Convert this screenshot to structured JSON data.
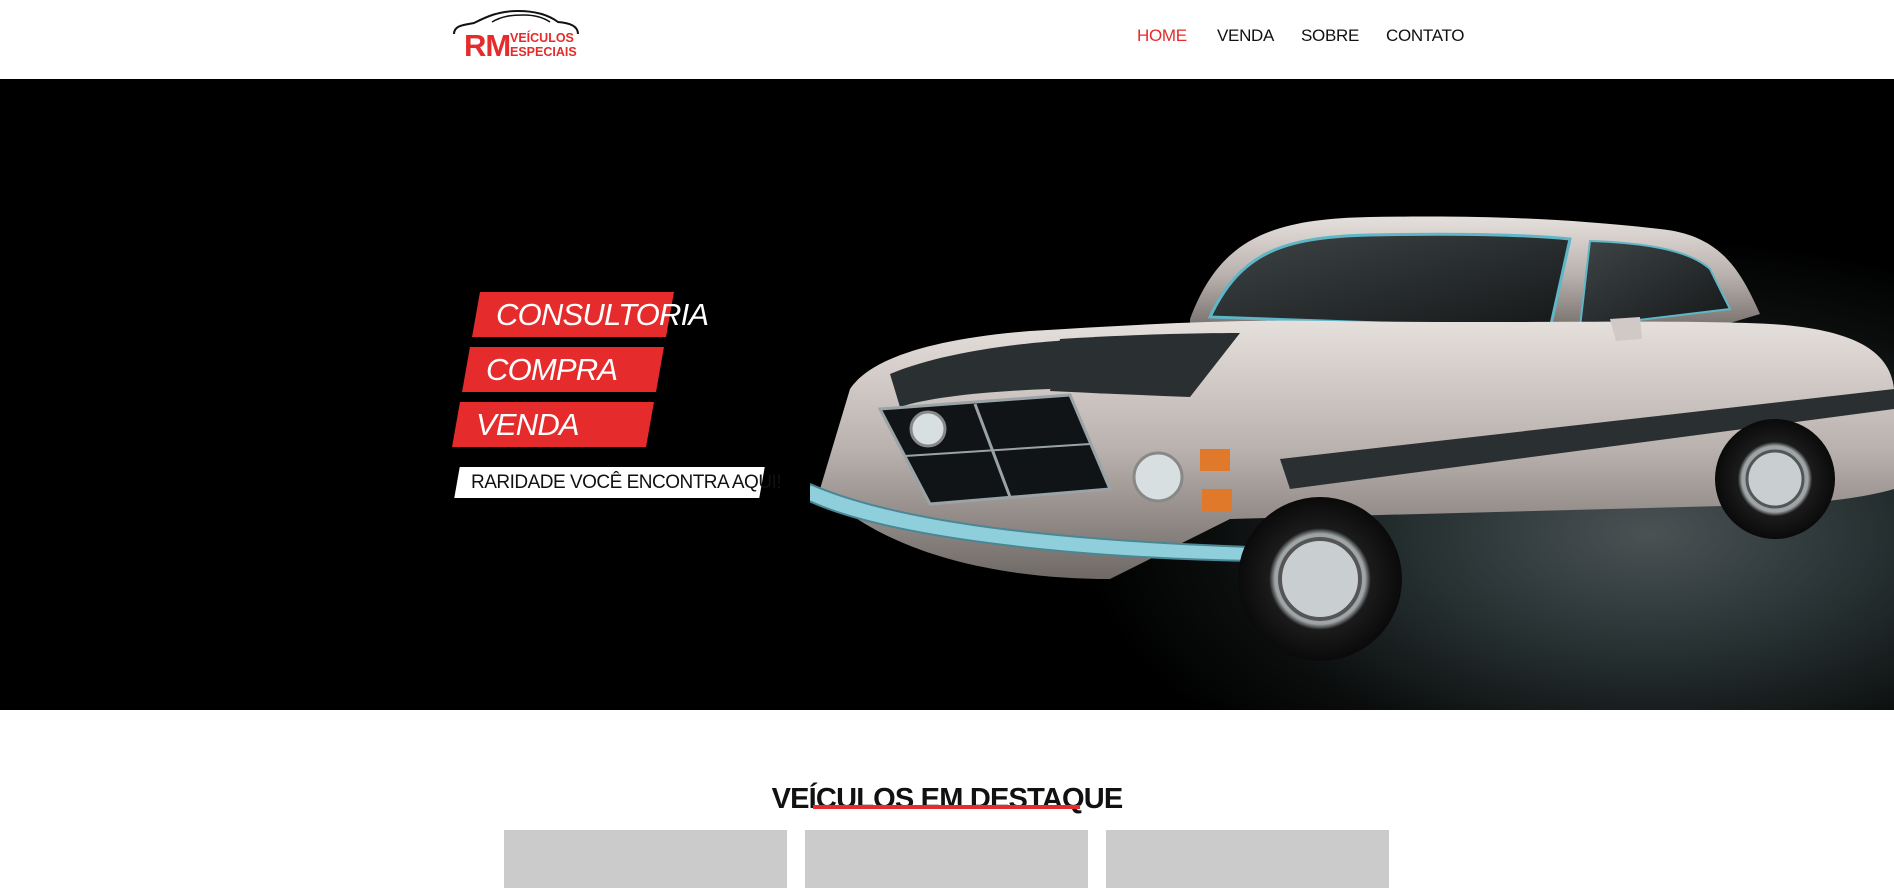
{
  "brand": {
    "initials": "RM",
    "line1": "VEÍCULOS",
    "line2": "ESPECIAIS",
    "accent_color": "#e52b2b"
  },
  "nav": {
    "items": [
      {
        "label": "HOME",
        "active": true
      },
      {
        "label": "VENDA",
        "active": false
      },
      {
        "label": "SOBRE",
        "active": false
      },
      {
        "label": "CONTATO",
        "active": false
      }
    ]
  },
  "hero": {
    "tags": [
      "CONSULTORIA",
      "COMPRA",
      "VENDA"
    ],
    "slogan": "RARIDADE VOCÊ ENCONTRA AQUI!",
    "background_color": "#000000"
  },
  "featured": {
    "title": "VEÍCULOS EM DESTAQUE",
    "placeholder_color": "#cbcbcb"
  }
}
